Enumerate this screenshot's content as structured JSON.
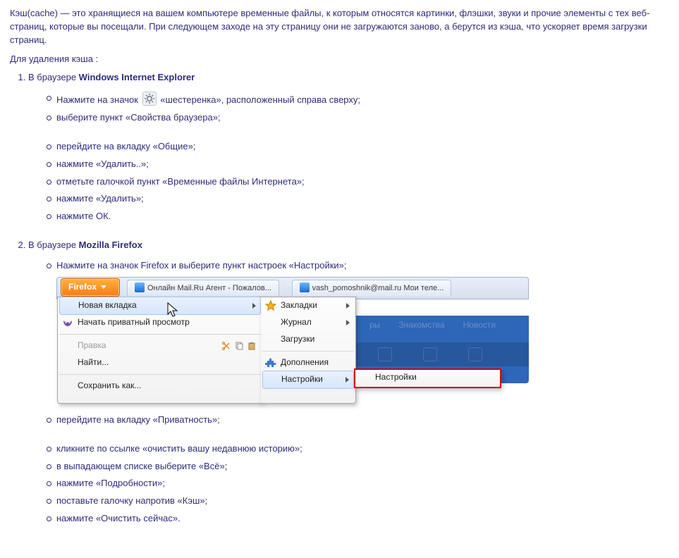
{
  "intro": "Кэш(cache) — это хранящиеся на вашем компьютере временные файлы, к которым относятся картинки, флэшки, звуки и прочие элементы с тех веб-страниц, которые вы посещали. При следующем заходе на эту страницу они не загружаются заново, а берутся из кэша, что ускоряет время загрузки страниц.",
  "lead": "Для удаления кэша :",
  "ie": {
    "prefix": "В браузере ",
    "name": "Windows Internet Explorer",
    "s1a": "Нажмите на значок",
    "s1b": "«шестеренка», расположенный справа сверху;",
    "s2": "выберите пункт «Свойства браузера»;",
    "s3": "перейдите на вкладку «Общие»;",
    "s4": "нажмите «Удалить..»;",
    "s5": "отметьте галочкой пункт «Временные файлы Интернета»;",
    "s6": "нажмите «Удалить»;",
    "s7": "нажмите ОК."
  },
  "ff": {
    "prefix": "В браузере ",
    "name": "Mozilla Firefox",
    "s1": "Нажмите на значок Firefox и выберите пункт настроек «Настройки»;",
    "s2": "перейдите на вкладку «Приватность»;",
    "s3": "кликните по ссылке «очистить вашу недавнюю историю»;",
    "s4": "в выпадающем списке выберите «Всё»;",
    "s5": "нажмите «Подробности»;",
    "s6": "поставьте галочку напротив «Кэш»;",
    "s7": "нажмите «Очистить сейчас»."
  },
  "menu": {
    "btn": "Firefox",
    "tab1": "Онлайн Mail.Ru Агент - Пожалов...",
    "tab2": "vash_pomoshnik@mail.ru Мои теле...",
    "m_new": "Новая вкладка",
    "m_priv": "Начать приватный просмотр",
    "m_edit": "Правка",
    "m_find": "Найти...",
    "m_save": "Сохранить как...",
    "m_book": "Закладки",
    "m_hist": "Журнал",
    "m_down": "Загрузки",
    "m_addon": "Дополнения",
    "m_pref": "Настройки",
    "m_pref2": "Настройки",
    "back1": "ры",
    "back2": "Знакомства",
    "back3": "Новости"
  }
}
